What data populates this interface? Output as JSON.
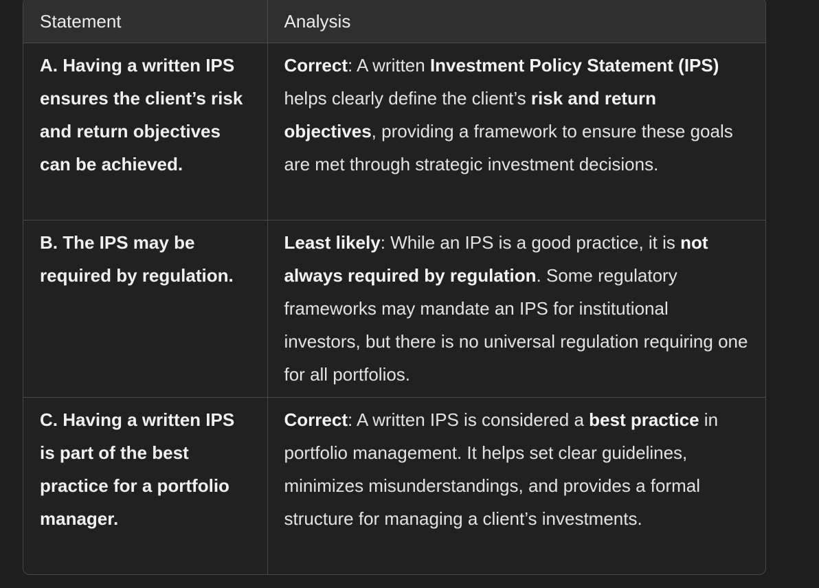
{
  "table": {
    "headers": [
      "Statement",
      "Analysis"
    ],
    "rows": [
      {
        "statement": "A. Having a written IPS ensures the client’s risk and return objectives can be achieved.",
        "analysis": [
          {
            "text": "Correct",
            "bold": true
          },
          {
            "text": ": A written ",
            "bold": false
          },
          {
            "text": "Investment Policy Statement (IPS)",
            "bold": true
          },
          {
            "text": " helps clearly define the client’s ",
            "bold": false
          },
          {
            "text": "risk and return objectives",
            "bold": true
          },
          {
            "text": ", providing a framework to ensure these goals are met through strategic investment decisions.",
            "bold": false
          }
        ]
      },
      {
        "statement": "B. The IPS may be required by regulation.",
        "analysis": [
          {
            "text": "Least likely",
            "bold": true
          },
          {
            "text": ": While an IPS is a good practice, it is ",
            "bold": false
          },
          {
            "text": "not always required by regulation",
            "bold": true
          },
          {
            "text": ". Some regulatory frameworks may mandate an IPS for institutional investors, but there is no universal regulation requiring one for all portfolios.",
            "bold": false
          }
        ]
      },
      {
        "statement": "C. Having a written IPS is part of the best practice for a portfolio manager.",
        "analysis": [
          {
            "text": "Correct",
            "bold": true
          },
          {
            "text": ": A written IPS is considered a ",
            "bold": false
          },
          {
            "text": "best practice",
            "bold": true
          },
          {
            "text": " in portfolio management. It helps set clear guidelines, minimizes misunderstandings, and provides a formal structure for managing a client’s investments.",
            "bold": false
          }
        ]
      }
    ]
  }
}
